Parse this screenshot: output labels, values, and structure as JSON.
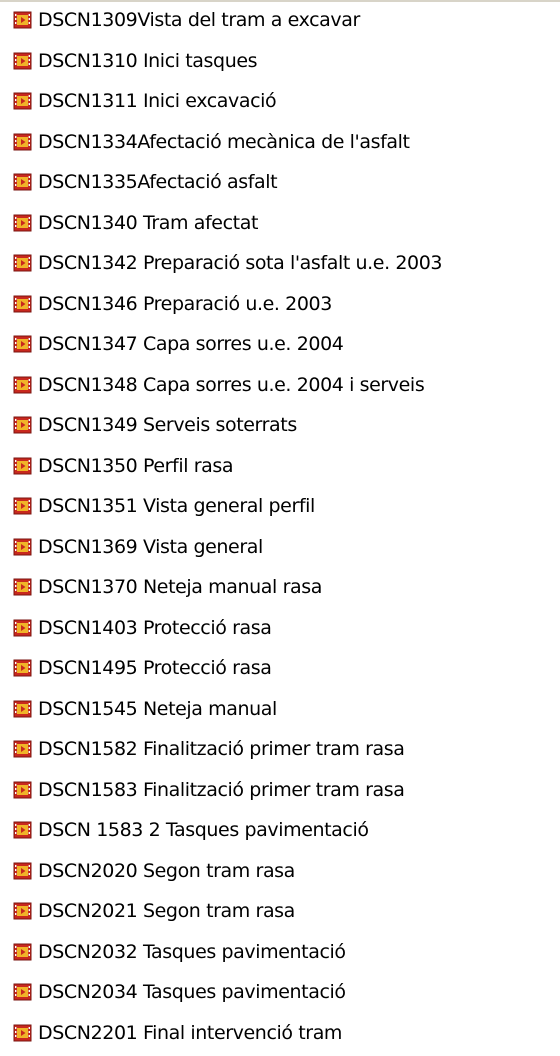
{
  "colors": {
    "background": "#ffffff",
    "text": "#000000",
    "icon_red": "#c8281e",
    "icon_yellow": "#f0b428"
  },
  "file_icon": "video-file-icon",
  "files": [
    {
      "label": "DSCN1309Vista del tram a excavar"
    },
    {
      "label": "DSCN1310 Inici tasques"
    },
    {
      "label": "DSCN1311 Inici excavació"
    },
    {
      "label": "DSCN1334Afectació mecànica de l'asfalt"
    },
    {
      "label": "DSCN1335Afectació asfalt"
    },
    {
      "label": "DSCN1340 Tram afectat"
    },
    {
      "label": "DSCN1342 Preparació sota l'asfalt u.e. 2003"
    },
    {
      "label": "DSCN1346 Preparació u.e. 2003"
    },
    {
      "label": "DSCN1347 Capa sorres u.e. 2004"
    },
    {
      "label": "DSCN1348 Capa sorres u.e. 2004 i serveis"
    },
    {
      "label": "DSCN1349 Serveis soterrats"
    },
    {
      "label": "DSCN1350 Perfil rasa"
    },
    {
      "label": "DSCN1351 Vista general perfil"
    },
    {
      "label": "DSCN1369 Vista general"
    },
    {
      "label": "DSCN1370 Neteja manual rasa"
    },
    {
      "label": "DSCN1403 Protecció rasa"
    },
    {
      "label": "DSCN1495 Protecció rasa"
    },
    {
      "label": "DSCN1545 Neteja manual"
    },
    {
      "label": "DSCN1582 Finalització primer tram rasa"
    },
    {
      "label": "DSCN1583 Finalització primer tram rasa"
    },
    {
      "label": "DSCN 1583 2 Tasques pavimentació"
    },
    {
      "label": "DSCN2020 Segon tram rasa"
    },
    {
      "label": "DSCN2021 Segon tram rasa"
    },
    {
      "label": "DSCN2032 Tasques pavimentació"
    },
    {
      "label": "DSCN2034 Tasques pavimentació"
    },
    {
      "label": "DSCN2201 Final intervenció tram"
    }
  ]
}
